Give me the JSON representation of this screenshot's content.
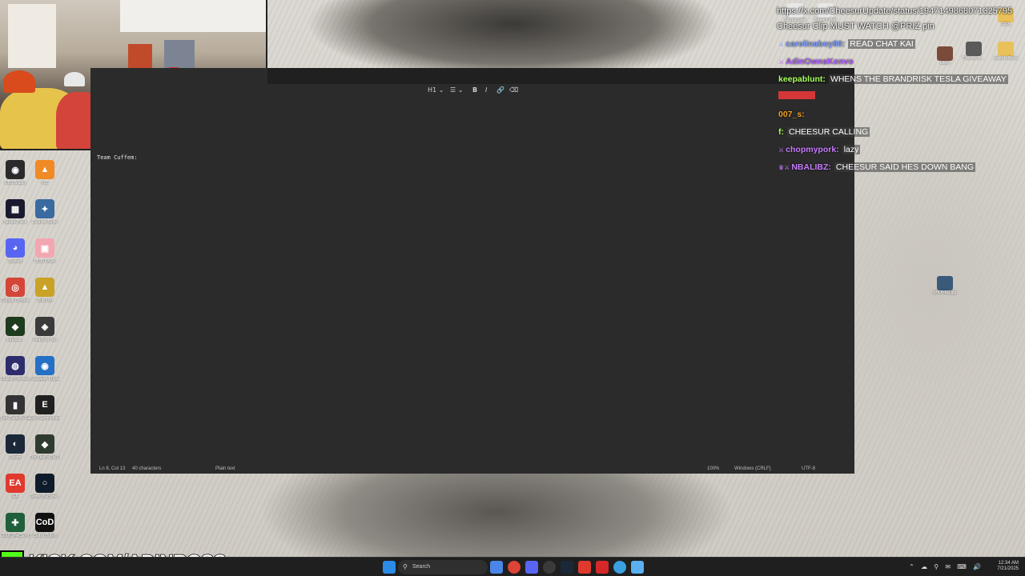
{
  "webcam": {
    "label": "streamer webcam"
  },
  "editor": {
    "toolbar": {
      "heading": "H1",
      "list": "☰",
      "bold": "B",
      "italic": "I",
      "link": "🔗",
      "clear": "⌫"
    },
    "content": "Team Cuffem:",
    "status": {
      "position": "Ln 8, Col 13",
      "characters": "40 characters",
      "format": "Plain text",
      "zoom": "100%",
      "line_ending": "Windows (CRLF)",
      "encoding": "UTF-8"
    }
  },
  "desktop_icons_left": [
    {
      "label": "OBS Studio",
      "icon": "obs-icon",
      "color": "#2a2a2a",
      "glyph": "◉"
    },
    {
      "label": "VLC",
      "icon": "vlc-icon",
      "color": "#f08a24",
      "glyph": "▲"
    },
    {
      "label": "Stream Deck",
      "icon": "streamdeck-icon",
      "color": "#1a1a2e",
      "glyph": "▦"
    },
    {
      "label": "Counter-Strike",
      "icon": "cs-icon",
      "color": "#3b6aa0",
      "glyph": "✦"
    },
    {
      "label": "Discord",
      "icon": "discord-icon",
      "color": "#5865f2",
      "glyph": "◕"
    },
    {
      "label": "PICO PARK",
      "icon": "picopark-icon",
      "color": "#f2a7b0",
      "glyph": "▣"
    },
    {
      "label": "Google Chrome",
      "icon": "chrome-icon",
      "color": "#d44638",
      "glyph": "◎"
    },
    {
      "label": "Only Up!",
      "icon": "onlyup-icon",
      "color": "#c9a227",
      "glyph": "▲"
    },
    {
      "label": "Jurassic...",
      "icon": "jurassic-icon",
      "color": "#1d3b1d",
      "glyph": "◆"
    },
    {
      "label": "Ready or Not",
      "icon": "readyornot-icon",
      "color": "#3a3a3a",
      "glyph": "◈"
    },
    {
      "label": "Ubisoft Connect",
      "icon": "ubisoft-icon",
      "color": "#2d2d6e",
      "glyph": "◍"
    },
    {
      "label": "Wallpaper Engine",
      "icon": "wallpaper-engine-icon",
      "color": "#2470c4",
      "glyph": "◉"
    },
    {
      "label": "Tom Clancy's Rainbow Six...",
      "icon": "r6-icon",
      "color": "#333333",
      "glyph": "▮"
    },
    {
      "label": "Epic Games Launcher",
      "icon": "epic-icon",
      "color": "#202020",
      "glyph": "E"
    },
    {
      "label": "Steam",
      "icon": "steam-icon",
      "color": "#1b2838",
      "glyph": "◐"
    },
    {
      "label": "The Last of Us Part I",
      "icon": "tlou-icon",
      "color": "#2f3b2f",
      "glyph": "◆"
    },
    {
      "label": "EA",
      "icon": "ea-icon",
      "color": "#e03a2f",
      "glyph": "EA"
    },
    {
      "label": "Detroit Become...",
      "icon": "detroit-icon",
      "color": "#0e1b2a",
      "glyph": "○"
    },
    {
      "label": "EVERSPACE PLAYER",
      "icon": "everspace-icon",
      "color": "#1f5f3a",
      "glyph": "✚"
    },
    {
      "label": "Call of Duty®",
      "icon": "cod-icon",
      "color": "#111111",
      "glyph": "CoD"
    }
  ],
  "desktop_icons_right": [
    {
      "label": "Stream plan",
      "icon": "document-icon",
      "color": "#e8e8e8"
    },
    {
      "label": "Stream Plan",
      "icon": "document-icon",
      "color": "#e8e8e8"
    },
    {
      "label": "GIFS",
      "icon": "folder-icon",
      "color": "#e8c15a"
    },
    {
      "label": "adinn",
      "icon": "photo-icon",
      "color": "#7a4a3a"
    },
    {
      "label": "Cheesur's ...",
      "icon": "avatar-icon",
      "color": "#5a5a5a"
    },
    {
      "label": "sound effects",
      "icon": "folder-icon",
      "color": "#e8c15a"
    },
    {
      "label": "pHONKE.jpg",
      "icon": "photo-icon",
      "color": "#3a5a7a"
    }
  ],
  "chat": {
    "url": "https://x.com/CheesurUpdate/status/1947149868071325795",
    "clip": "Cheesur Clip MUST WATCH @PRIZ pin",
    "messages": [
      {
        "user": "carolinaboy80:",
        "color": "#7b9cff",
        "badge": "⚔",
        "text": "READ CHAT KAI"
      },
      {
        "user": "AdinOwnsKonvo",
        "color": "#b05cff",
        "badge": "⚔",
        "text": ""
      },
      {
        "user": "keepablunt:",
        "color": "#a8ff60",
        "badge": "",
        "text": "WHENS THE BRANDRISK TESLA GIVEAWAY"
      },
      {
        "user": "",
        "color": "#ff3b3b",
        "badge": "",
        "text": ""
      },
      {
        "user": "007_s:",
        "color": "#f0a020",
        "badge": "",
        "text": ""
      },
      {
        "user": "f:",
        "color": "#a8ff60",
        "badge": "",
        "text": "CHEESUR CALLING"
      },
      {
        "user": "chopmypork:",
        "color": "#c77dff",
        "badge": "⚔",
        "text": "lazy"
      },
      {
        "user": "NBALIBZ:",
        "color": "#c77dff",
        "badge": "♛⚔",
        "text": "CHEESUR SAID HES DOWN BANG"
      }
    ]
  },
  "banner": {
    "logo": "K",
    "text": "KICK.COM/ADINROSS"
  },
  "taskbar": {
    "search_placeholder": "Search",
    "time": "12:34 AM",
    "date": "7/21/2025",
    "tray": "⌃ ☁ ⚲ ✉ ⌨ 🔊"
  }
}
